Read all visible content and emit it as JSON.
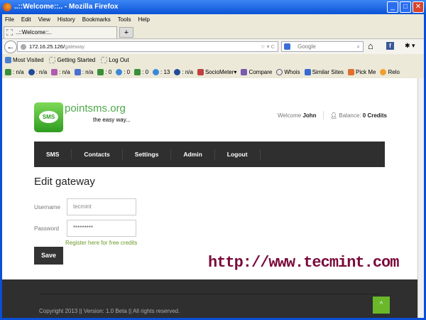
{
  "window": {
    "title": "..::Welcome::.. - Mozilla Firefox",
    "minimize": "_",
    "maximize": "□",
    "close": "✕"
  },
  "menu": [
    "File",
    "Edit",
    "View",
    "History",
    "Bookmarks",
    "Tools",
    "Help"
  ],
  "tab": {
    "title": "..::Welcome::..",
    "new_tab": "+"
  },
  "nav": {
    "back": "←",
    "url_host": "172.16.25.126/",
    "url_path": "gateway",
    "star": "☆ ▾ C",
    "search_placeholder": "Google",
    "home": "⌂",
    "fb": "f"
  },
  "bookmarks": [
    "Most Visited",
    "Getting Started",
    "Log Out"
  ],
  "addons": [
    ": n/a",
    ": n/a",
    ": n/a",
    ": n/a",
    ": 0",
    ": 0",
    ": 0",
    ": 13",
    ": n/a",
    "SocioMeter▾",
    "Compare",
    "Whois",
    "Similar Sites",
    "Pick Me",
    "Relo"
  ],
  "site": {
    "logo_text": "SMS",
    "brand": "pointsms.org",
    "tagline": "the easy way...",
    "welcome_label": "Welcome",
    "user": "John",
    "balance_label": "Balance:",
    "balance": "0 Credits",
    "nav": [
      "SMS",
      "Contacts",
      "Settings",
      "Admin",
      "Logout"
    ],
    "page_title": "Edit gateway",
    "username_label": "Username",
    "username_value": "tecmint",
    "password_label": "Password",
    "password_value": "*********",
    "register_link": "Register here for free credits",
    "save": "Save",
    "copyright": "Copyright 2013 || Version: 1.0 Beta || All rights reserved.",
    "to_top": "^"
  },
  "watermark": "http://www.tecmint.com",
  "colors": {
    "accent_green": "#6ab82a",
    "nav_dark": "#2f2f2f",
    "watermark": "#7a0a3a"
  }
}
